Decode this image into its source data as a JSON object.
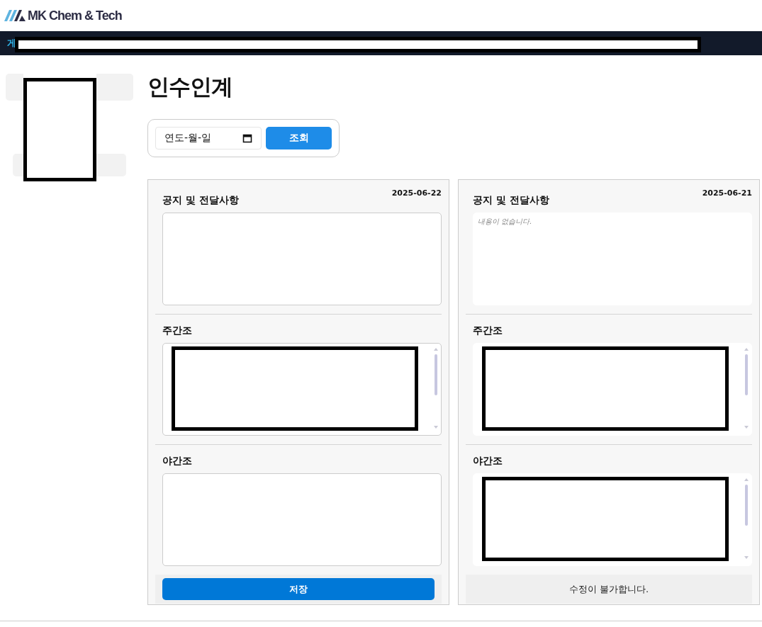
{
  "logo": {
    "text": "MK Chem & Tech"
  },
  "nav": {
    "items": [
      {
        "label": "게",
        "selected": true
      }
    ]
  },
  "page_title": "인수인계",
  "filter": {
    "date_placeholder": "연도-월-일",
    "button": "조회"
  },
  "cards": [
    {
      "date": "2025-06-22",
      "editable": true,
      "sections": [
        {
          "title": "공지 및 전달사항",
          "redacted": false
        },
        {
          "title": "주간조",
          "redacted": true
        },
        {
          "title": "야간조",
          "redacted": false
        }
      ],
      "footer": "저장"
    },
    {
      "date": "2025-06-21",
      "editable": false,
      "sections": [
        {
          "title": "공지 및 전달사항",
          "placeholder": "내용이 없습니다.",
          "redacted": false
        },
        {
          "title": "주간조",
          "redacted": true
        },
        {
          "title": "야간조",
          "redacted": true
        }
      ],
      "footer": "수정이 불가합니다."
    }
  ]
}
